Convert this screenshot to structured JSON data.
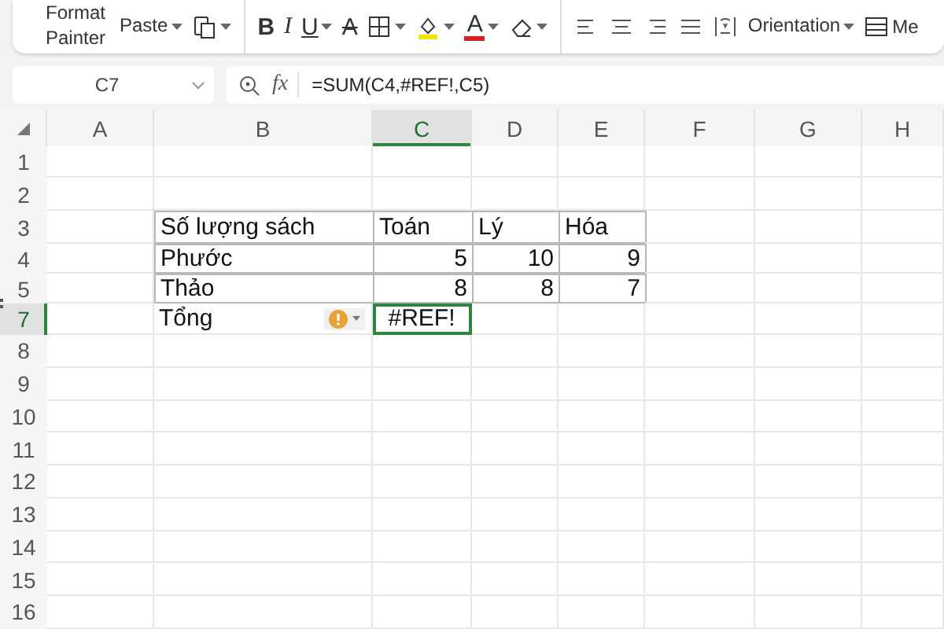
{
  "ribbon": {
    "groups": [
      [
        {
          "kind": "text",
          "label": "Format Painter",
          "dropdown": false
        },
        {
          "kind": "text",
          "label": "Paste",
          "dropdown": true
        },
        {
          "kind": "clipboard",
          "dropdown": true
        }
      ],
      [
        {
          "kind": "bold",
          "label": "B",
          "dropdown": false
        },
        {
          "kind": "italic",
          "label": "I",
          "dropdown": false
        },
        {
          "kind": "underline",
          "label": "U",
          "dropdown": true
        },
        {
          "kind": "strike",
          "label": "A",
          "dropdown": false
        },
        {
          "kind": "borders",
          "dropdown": true
        },
        {
          "kind": "fill",
          "dropdown": true
        },
        {
          "kind": "font-color",
          "label": "A",
          "dropdown": true
        },
        {
          "kind": "eraser",
          "dropdown": true
        }
      ],
      [
        {
          "kind": "align-left",
          "dropdown": false
        },
        {
          "kind": "align-center",
          "dropdown": false
        },
        {
          "kind": "align-right",
          "dropdown": false
        },
        {
          "kind": "justify",
          "dropdown": false
        },
        {
          "kind": "wrap",
          "dropdown": false
        },
        {
          "kind": "text",
          "label": "Orientation",
          "dropdown": true
        },
        {
          "kind": "merge",
          "label": "Me",
          "dropdown": false
        }
      ]
    ]
  },
  "formula_bar": {
    "name_box": "C7",
    "fx": "fx",
    "formula": "=SUM(C4,#REF!,C5)"
  },
  "columns": [
    {
      "label": "A",
      "selected": false
    },
    {
      "label": "B",
      "selected": false
    },
    {
      "label": "C",
      "selected": true
    },
    {
      "label": "D",
      "selected": false
    },
    {
      "label": "E",
      "selected": false
    },
    {
      "label": "F",
      "selected": false
    },
    {
      "label": "G",
      "selected": false
    },
    {
      "label": "H",
      "selected": false
    }
  ],
  "rows": [
    {
      "label": "1",
      "selected": false,
      "hidden_above": false
    },
    {
      "label": "2",
      "selected": false,
      "hidden_above": false
    },
    {
      "label": "3",
      "selected": false,
      "hidden_above": false,
      "cells": [
        null,
        {
          "text": "Số lượng sách",
          "kind": "text",
          "bordered": true
        },
        {
          "text": "Toán",
          "kind": "text",
          "bordered": true
        },
        {
          "text": "Lý",
          "kind": "text",
          "bordered": true
        },
        {
          "text": "Hóa",
          "kind": "text",
          "bordered": true
        }
      ]
    },
    {
      "label": "4",
      "selected": false,
      "hidden_above": false,
      "cells": [
        null,
        {
          "text": "Phước",
          "kind": "text",
          "bordered": true
        },
        {
          "text": "5",
          "kind": "number",
          "bordered": true
        },
        {
          "text": "10",
          "kind": "number",
          "bordered": true
        },
        {
          "text": "9",
          "kind": "number",
          "bordered": true
        }
      ]
    },
    {
      "label": "5",
      "selected": false,
      "hidden_above": false,
      "cells": [
        null,
        {
          "text": "Thảo",
          "kind": "text",
          "bordered": true
        },
        {
          "text": "8",
          "kind": "number",
          "bordered": true
        },
        {
          "text": "8",
          "kind": "number",
          "bordered": true
        },
        {
          "text": "7",
          "kind": "number",
          "bordered": true
        }
      ]
    },
    {
      "label": "7",
      "selected": true,
      "hidden_above": true,
      "cells": [
        null,
        {
          "text": "Tổng",
          "kind": "text",
          "bordered": false,
          "warning": true
        },
        {
          "text": "#REF!",
          "kind": "error",
          "bordered": false,
          "selected": true
        }
      ]
    },
    {
      "label": "8",
      "selected": false,
      "hidden_above": false
    },
    {
      "label": "9",
      "selected": false,
      "hidden_above": false
    },
    {
      "label": "10",
      "selected": false,
      "hidden_above": false
    },
    {
      "label": "11",
      "selected": false,
      "hidden_above": false
    },
    {
      "label": "12",
      "selected": false,
      "hidden_above": false
    },
    {
      "label": "13",
      "selected": false,
      "hidden_above": false
    },
    {
      "label": "14",
      "selected": false,
      "hidden_above": false
    },
    {
      "label": "15",
      "selected": false,
      "hidden_above": false
    },
    {
      "label": "16",
      "selected": false,
      "hidden_above": false
    }
  ]
}
